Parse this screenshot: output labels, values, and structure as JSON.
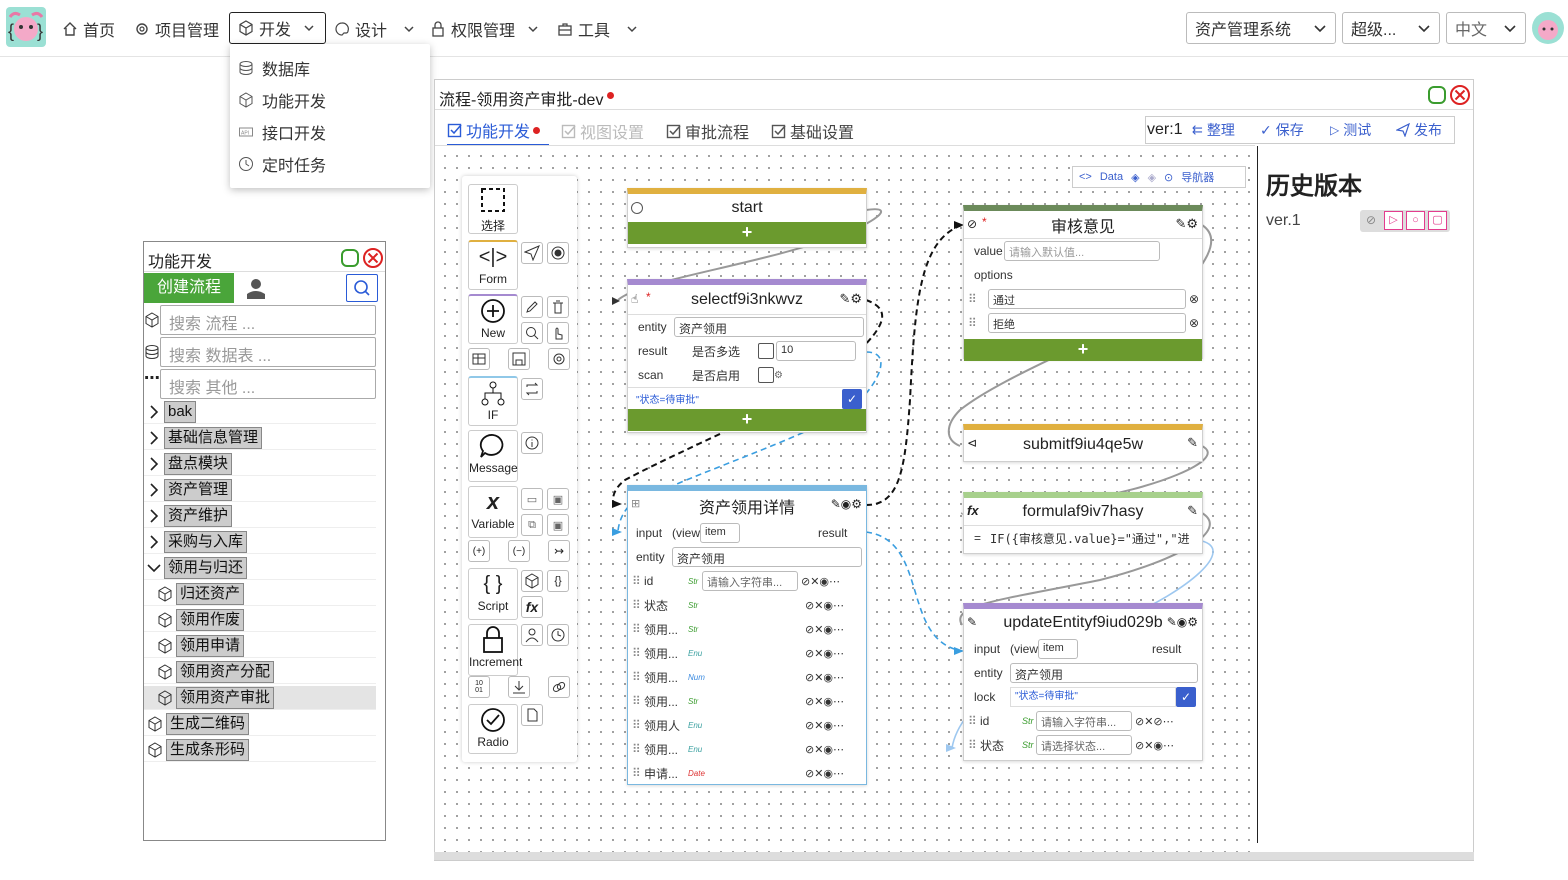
{
  "nav": {
    "home": "首页",
    "project": "项目管理",
    "dev": "开发",
    "design": "设计",
    "perm": "权限管理",
    "tools": "工具"
  },
  "top_right": {
    "system": "资产管理系统",
    "role": "超级...",
    "lang": "中文"
  },
  "dev_menu": [
    "数据库",
    "功能开发",
    "接口开发",
    "定时任务"
  ],
  "left_panel": {
    "title": "功能开发",
    "create_btn": "创建流程",
    "search_flow": "搜索 流程 ...",
    "search_table": "搜索 数据表 ...",
    "search_other": "搜索 其他 ...",
    "tree": [
      "bak",
      "基础信息管理",
      "盘点模块",
      "资产管理",
      "资产维护",
      "采购与入库",
      "领用与归还"
    ],
    "children": [
      "归还资产",
      "领用作废",
      "领用申请",
      "领用资产分配",
      "领用资产审批"
    ],
    "tail": [
      "生成二维码",
      "生成条形码"
    ]
  },
  "editor": {
    "title": "流程-领用资产审批-dev",
    "tabs": [
      "功能开发",
      "视图设置",
      "审批流程",
      "基础设置"
    ],
    "ver": "ver:1",
    "actions": [
      "整理",
      "保存",
      "测试",
      "发布"
    ],
    "data_btn": "Data",
    "nav_btn": "导航器"
  },
  "history": {
    "title": "历史版本",
    "item": "ver.1"
  },
  "toolbox": [
    "选择",
    "Form",
    "New",
    "IF",
    "Message",
    "Variable",
    "Script",
    "Increment",
    "Radio"
  ],
  "nodes": {
    "start": "start",
    "select": {
      "title": "selectf9i3nkwvz",
      "entity_label": "entity",
      "entity": "资产领用",
      "result": "result",
      "multi": "是否多选",
      "limit": "10",
      "scan": "scan",
      "enable": "是否启用",
      "cond": "\"状态=待审批\""
    },
    "detail": {
      "title": "资产领用详情",
      "input": "input",
      "view": "(view",
      "item": "item",
      "result": "result",
      "entity_label": "entity",
      "entity": "资产领用",
      "fields": [
        "id",
        "状态",
        "领用...",
        "领用...",
        "领用...",
        "领用...",
        "领用人",
        "领用...",
        "申请..."
      ],
      "types": [
        "Str",
        "Str",
        "Str",
        "Enu",
        "Num",
        "Str",
        "Enu",
        "Enu",
        "Date"
      ],
      "id_ph": "请输入字符串..."
    },
    "review": {
      "title": "审核意见",
      "value_label": "value",
      "value_ph": "请输入默认值...",
      "options_label": "options",
      "opts": [
        "通过",
        "拒绝"
      ]
    },
    "submit": "submitf9iu4qe5w",
    "formula": {
      "title": "formulaf9iv7hasy",
      "expr": "IF({审核意见.value}=\"通过\",\"进"
    },
    "update": {
      "title": "updateEntityf9iud029b",
      "input": "input",
      "view": "(view",
      "item": "item",
      "result": "result",
      "entity_label": "entity",
      "entity": "资产领用",
      "lock": "lock",
      "lock_val": "\"状态=待审批\"",
      "f1": "id",
      "f2": "状态",
      "f1_ph": "请输入字符串...",
      "f2_ph": "请选择状态..."
    }
  }
}
